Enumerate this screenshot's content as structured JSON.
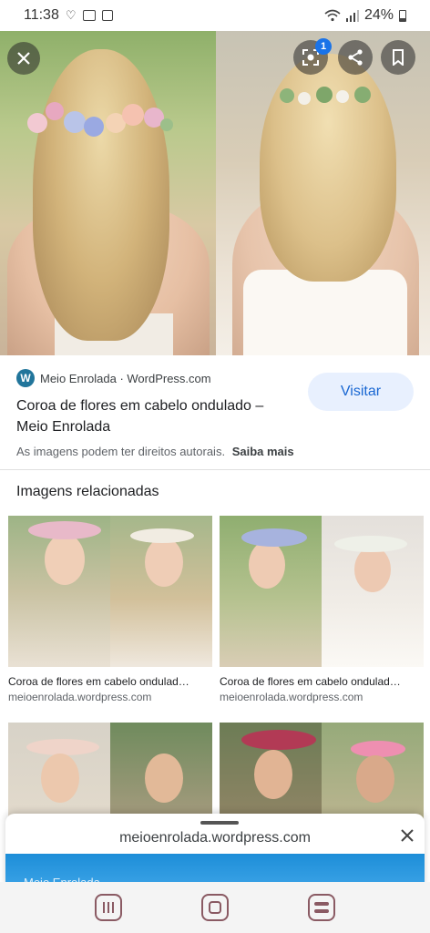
{
  "status_bar": {
    "time": "11:38",
    "battery": "24%",
    "icons": [
      "heart-icon",
      "gallery-icon",
      "notification-icon",
      "wifi-icon",
      "signal-icon",
      "battery-icon"
    ]
  },
  "viewer": {
    "lens_badge_count": "1",
    "icons": [
      "close-icon",
      "google-lens-icon",
      "share-icon",
      "bookmark-icon"
    ]
  },
  "result": {
    "source": "Meio Enrolada · WordPress.com",
    "title": "Coroa de flores em cabelo ondulado – Meio Enrolada",
    "visit_label": "Visitar",
    "copyright_text": "As imagens podem ter direitos autorais.",
    "learn_more_label": "Saiba mais"
  },
  "related": {
    "heading": "Imagens relacionadas",
    "items": [
      {
        "title": "Coroa de flores em cabelo ondulad…",
        "domain": "meioenrolada.wordpress.com"
      },
      {
        "title": "Coroa de flores em cabelo ondulad…",
        "domain": "meioenrolada.wordpress.com"
      },
      {
        "title": "",
        "domain": ""
      },
      {
        "title": "",
        "domain": ""
      }
    ]
  },
  "sheet": {
    "url": "meioenrolada.wordpress.com",
    "preview_text": "Meio Enrolada"
  },
  "colors": {
    "accent": "#1967d2",
    "visit_bg": "#e8f0fe",
    "nav_icon": "#8a5a63"
  }
}
